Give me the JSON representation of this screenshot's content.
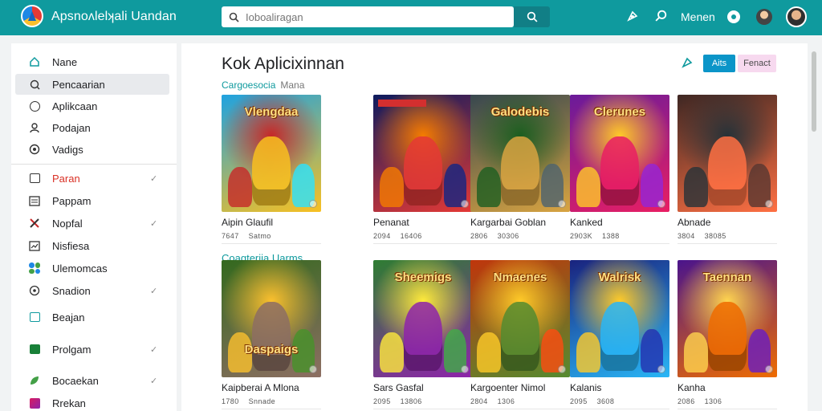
{
  "header": {
    "app_title": "Apsnoʌlelʞali Uandan",
    "search_placeholder": "Ioboaliragan",
    "menu_label": "Menen",
    "icons": [
      "logo-icon",
      "search-icon",
      "puzzle-icon",
      "magnifier-icon",
      "settings-dot-icon",
      "user-avatar"
    ]
  },
  "sidebar": {
    "items": [
      {
        "label": "Nane",
        "icon": "home-icon",
        "active": false,
        "check": false
      },
      {
        "label": "Pencaarian",
        "icon": "search-icon",
        "active": true,
        "check": false
      },
      {
        "label": "Aplikcaan",
        "icon": "apps-icon",
        "active": false,
        "check": false
      },
      {
        "label": "Podajan",
        "icon": "profile-icon",
        "active": false,
        "check": false
      },
      {
        "label": "Vadigs",
        "icon": "settings-icon",
        "active": false,
        "check": false
      },
      {
        "label": "Paran",
        "icon": "calendar-icon",
        "active": false,
        "check": true
      },
      {
        "label": "Pappam",
        "icon": "list-icon",
        "active": false,
        "check": false
      },
      {
        "label": "Nopfal",
        "icon": "tools-icon",
        "active": false,
        "check": true
      },
      {
        "label": "Nisfiesa",
        "icon": "chart-icon",
        "active": false,
        "check": false
      },
      {
        "label": "Ulemomcas",
        "icon": "clover-icon",
        "active": false,
        "check": false
      },
      {
        "label": "Snadion",
        "icon": "target-icon",
        "active": false,
        "check": true
      },
      {
        "label": "Beajan",
        "icon": "card-icon",
        "active": false,
        "check": false
      },
      {
        "label": "Prolgam",
        "icon": "printer-icon",
        "active": false,
        "check": true
      },
      {
        "label": "Bocaekan",
        "icon": "leaf-icon",
        "active": false,
        "check": true
      },
      {
        "label": "Rrekan",
        "icon": "gallery-icon",
        "active": false,
        "check": false
      }
    ]
  },
  "main": {
    "title": "Kok Aplicixinnan",
    "primary_button": "Aits",
    "secondary_button": "Fenact",
    "section1": {
      "title": "Cargoesocia",
      "subtitle": "Mana"
    },
    "section2": {
      "title": "Coagteriia Uarms"
    },
    "row1": [
      {
        "title": "Aipin Glaufil",
        "meta": [
          "7647",
          "Satmo"
        ],
        "thumb": "Vlengdaa",
        "colors": [
          "#1fa2e0",
          "#f9c020",
          "#c62828"
        ]
      },
      {
        "title": "Penanat",
        "meta": [
          "2094",
          "16406"
        ],
        "thumb": "",
        "colors": [
          "#0d1b5e",
          "#e53935",
          "#f57c00"
        ]
      },
      {
        "title": "Kargarbai Goblan",
        "meta": [
          "2806",
          "30306"
        ],
        "thumb": "Galodebis",
        "colors": [
          "#37474f",
          "#d9a441",
          "#1b5e20"
        ]
      },
      {
        "title": "Kanked",
        "meta": [
          "2903K",
          "1388"
        ],
        "thumb": "Clerunes",
        "colors": [
          "#6a1b9a",
          "#e91e63",
          "#ffca28"
        ]
      },
      {
        "title": "Abnade",
        "meta": [
          "3804",
          "38085"
        ],
        "thumb": "",
        "colors": [
          "#3e2723",
          "#ff7043",
          "#263238"
        ]
      }
    ],
    "row2": [
      {
        "title": "Kaipberai A Mlona",
        "meta": [
          "1780",
          "Snnade"
        ],
        "thumb": "Daspaigs",
        "colors": [
          "#33691e",
          "#8d6e63",
          "#fbc02d"
        ]
      },
      {
        "title": "Sars Gasfal",
        "meta": [
          "2095",
          "13806"
        ],
        "thumb": "Sheemigs",
        "colors": [
          "#2e7d32",
          "#8e24aa",
          "#ffeb3b"
        ]
      },
      {
        "title": "Kargoenter Nimol",
        "meta": [
          "2804",
          "1306"
        ],
        "thumb": "Nmaenes",
        "colors": [
          "#bf360c",
          "#558b2f",
          "#ffca28"
        ]
      },
      {
        "title": "Kalanis",
        "meta": [
          "2095",
          "3608"
        ],
        "thumb": "Walrisk",
        "colors": [
          "#1a237e",
          "#29b6f6",
          "#ffca28"
        ]
      },
      {
        "title": "Kanha",
        "meta": [
          "2086",
          "1306"
        ],
        "thumb": "Taennan",
        "colors": [
          "#4a148c",
          "#ef6c00",
          "#ffd54f"
        ]
      }
    ]
  },
  "colors": {
    "topbar": "#0f9a9e",
    "accent": "#0f9a9e",
    "primary_button": "#0b95c8",
    "secondary_button": "#f7d9ef",
    "active_nav": "#e8eaed",
    "alert_text": "#d93025"
  }
}
